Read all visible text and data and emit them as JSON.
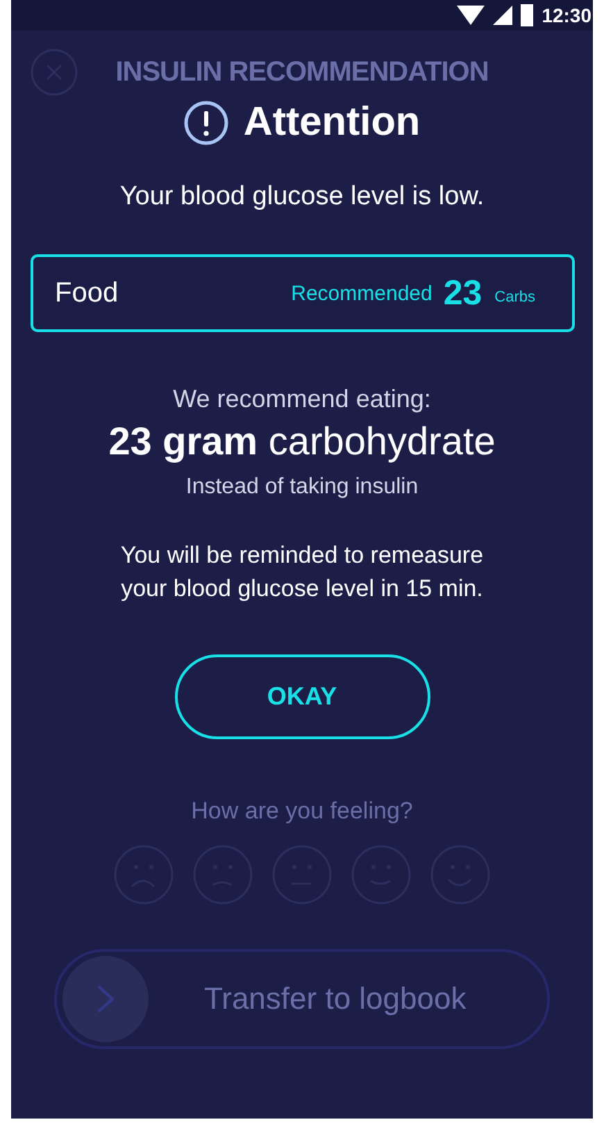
{
  "status_bar": {
    "time": "12:30"
  },
  "header": {
    "title": "INSULIN RECOMMENDATION"
  },
  "dialog": {
    "title": "Attention",
    "message": "Your blood glucose level is low.",
    "food_card": {
      "label": "Food",
      "caption": "Recommended",
      "value": "23",
      "unit": "Carbs"
    },
    "intro": "We recommend eating:",
    "amount": "**23 gram** carbohydrate",
    "note": "Instead of taking insulin",
    "reminder": "You will be reminded to remeasure your blood glucose level in 15 min.",
    "button": "OKAY"
  },
  "feeling": {
    "question": "How are you feeling?"
  },
  "transfer_button": {
    "label": "Transfer to logbook"
  }
}
